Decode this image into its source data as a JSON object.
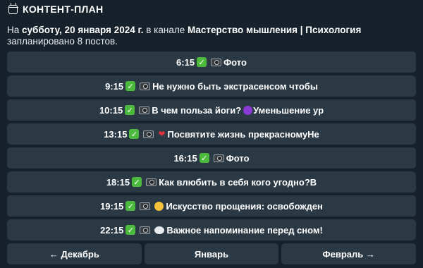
{
  "header": {
    "title": "КОНТЕНТ-ПЛАН",
    "icon": "calendar-icon"
  },
  "description": {
    "prefix": "На ",
    "date": "субботу, 20 января 2024 г.",
    "middle": " в канале ",
    "channel": "Мастерство мышления | Психология",
    "suffix": " запланировано 8 постов."
  },
  "posts": [
    {
      "time": "6:15",
      "icons": [
        "check-icon",
        "camera-icon"
      ],
      "title": "Фото"
    },
    {
      "time": "9:15",
      "icons": [
        "check-icon",
        "camera-icon"
      ],
      "title": "Не нужно быть экстрасенсом чтобы"
    },
    {
      "time": "10:15",
      "icons": [
        "check-icon",
        "camera-icon"
      ],
      "title": "В чем польза йоги?",
      "title_icon": "purple-circle-icon",
      "title_after": "Уменьшение ур"
    },
    {
      "time": "13:15",
      "icons": [
        "check-icon",
        "camera-icon",
        "heart-icon"
      ],
      "title": "Посвятите жизнь прекрасномуНе"
    },
    {
      "time": "16:15",
      "icons": [
        "check-icon",
        "camera-icon"
      ],
      "title": "Фото"
    },
    {
      "time": "18:15",
      "icons": [
        "check-icon",
        "camera-icon"
      ],
      "title": "Как влюбить в себя кого угодно?В"
    },
    {
      "time": "19:15",
      "icons": [
        "check-icon",
        "camera-icon",
        "smile-icon"
      ],
      "title": "Искусство прощения: освобожден"
    },
    {
      "time": "22:15",
      "icons": [
        "check-icon",
        "camera-icon",
        "thought-bubble-icon"
      ],
      "title": "Важное напоминание перед сном!"
    }
  ],
  "nav": {
    "prev_label": "← Декабрь",
    "current_label": "Январь",
    "next_label": "Февраль →"
  },
  "colors": {
    "background": "#17212b",
    "button": "#2b3945",
    "check": "#4cbb3d"
  }
}
